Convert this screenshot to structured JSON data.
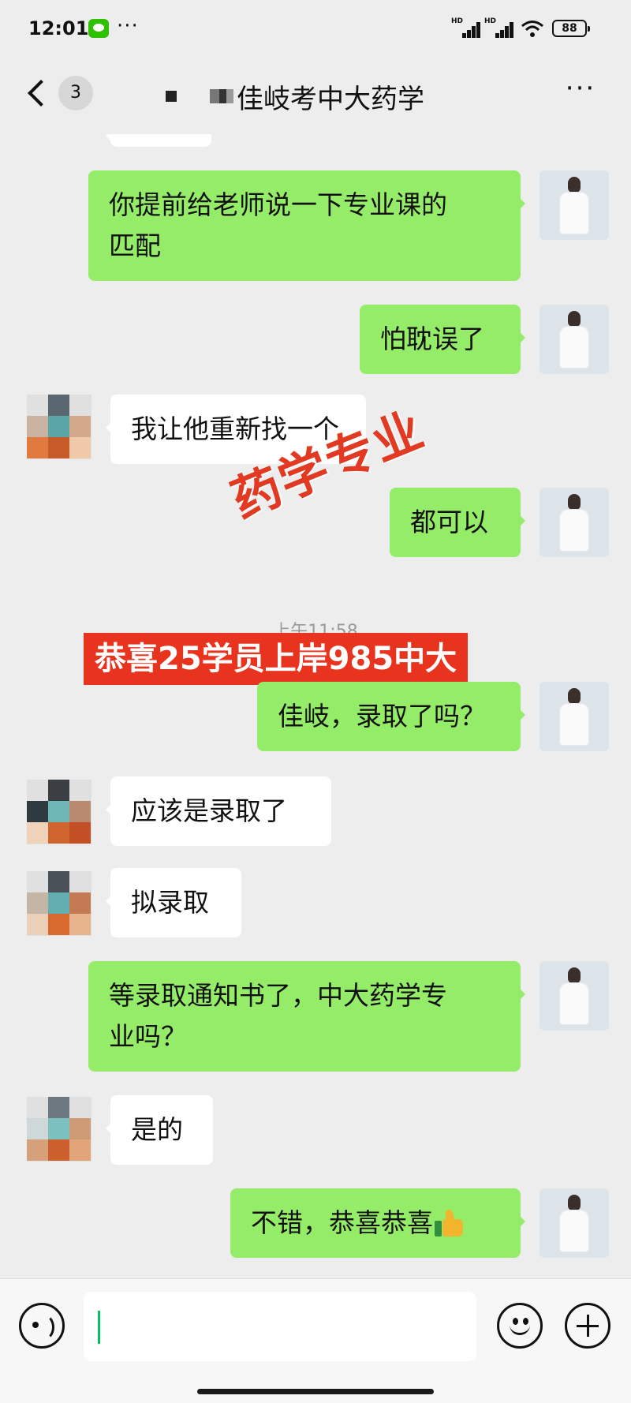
{
  "status_bar": {
    "time": "12:01",
    "more": "···",
    "battery": "88",
    "signal_labels": [
      "HD",
      "HD"
    ]
  },
  "header": {
    "back_badge": "3",
    "title": "佳岐考中大药学",
    "more": "···"
  },
  "overlay": {
    "stamp": "药学专业",
    "banner": "恭喜25学员上岸985中大"
  },
  "timestamp": "上午11:58",
  "messages": [
    {
      "side": "me",
      "lines": [
        "你提前给老师说一下专业课的",
        "匹配"
      ]
    },
    {
      "side": "me",
      "lines": [
        "怕耽误了"
      ]
    },
    {
      "side": "them",
      "lines": [
        "我让他重新找一个"
      ]
    },
    {
      "side": "me",
      "lines": [
        "都可以"
      ]
    },
    {
      "side": "me",
      "lines": [
        "佳岐，录取了吗？"
      ]
    },
    {
      "side": "them",
      "lines": [
        "应该是录取了"
      ]
    },
    {
      "side": "them",
      "lines": [
        "拟录取"
      ]
    },
    {
      "side": "me",
      "lines": [
        "等录取通知书了，中大药学专",
        "业吗？"
      ]
    },
    {
      "side": "them",
      "lines": [
        "是的"
      ]
    },
    {
      "side": "me",
      "lines": [
        "不错，恭喜恭喜"
      ],
      "emoji": "thumbs-up"
    }
  ],
  "input_bar": {
    "value": "",
    "icons": [
      "voice-icon",
      "emoji-icon",
      "plus-icon"
    ]
  },
  "colors": {
    "my_bubble": "#95ec69",
    "their_bubble": "#ffffff",
    "background": "#ededed",
    "banner": "#e8331f"
  }
}
